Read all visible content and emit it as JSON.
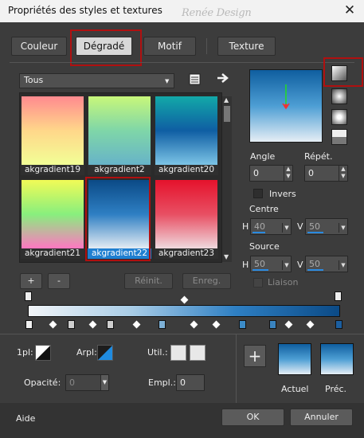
{
  "window": {
    "title": "Propriétés des styles et textures",
    "watermark": "Renée Design",
    "close": "✕"
  },
  "tabs": [
    {
      "label": "Couleur",
      "active": false
    },
    {
      "label": "Dégradé",
      "active": true
    },
    {
      "label": "Motif",
      "active": false
    },
    {
      "label": "Texture",
      "active": false
    }
  ],
  "category": {
    "value": "Tous"
  },
  "gradients": [
    {
      "name": "akgradient19",
      "colors": [
        "#ff8a8f",
        "#ffd78a",
        "#f2ff96"
      ]
    },
    {
      "name": "akgradient2",
      "colors": [
        "#c8f77a",
        "#7fd6a8",
        "#67b3c8"
      ]
    },
    {
      "name": "akgradient20",
      "colors": [
        "#12a9a8",
        "#0f5ea3",
        "#7cc4e6"
      ]
    },
    {
      "name": "akgradient21",
      "colors": [
        "#f1fb57",
        "#88ef7d",
        "#ff77c2"
      ]
    },
    {
      "name": "akgradient22",
      "colors": [
        "#0b4a86",
        "#2e7fc3",
        "#e4ecf3"
      ],
      "selected": true
    },
    {
      "name": "akgradient23",
      "colors": [
        "#e5122c",
        "#e84f63",
        "#efd9de"
      ]
    }
  ],
  "preview_gradient": {
    "colors": [
      "#0f5e9f",
      "#4d9ed4",
      "#e6eef5"
    ]
  },
  "styles": [
    "linear",
    "rectangular",
    "sunburst",
    "radial"
  ],
  "angle": {
    "label": "Angle",
    "value": "0"
  },
  "repeat": {
    "label": "Répét.",
    "value": "0"
  },
  "invert": {
    "label": "Invers",
    "checked": false
  },
  "center": {
    "label": "Centre",
    "h_label": "H",
    "h_value": "40",
    "v_label": "V",
    "v_value": "50"
  },
  "source": {
    "label": "Source",
    "h_label": "H",
    "h_value": "50",
    "v_label": "V",
    "v_value": "50",
    "link_label": "Liaison"
  },
  "buttons": {
    "add": "+",
    "remove": "-",
    "reset": "Réinit.",
    "save": "Enreg."
  },
  "bar_gradient": {
    "colors": [
      "#f2f5f8",
      "#a8cce6",
      "#2e7fc3",
      "#0b4a86"
    ]
  },
  "lower": {
    "pl_label": "1pl:",
    "arpl_label": "Arpl:",
    "util_label": "Util.:",
    "opacity_label": "Opacité:",
    "opacity_value": "0",
    "empl_label": "Empl.:",
    "empl_value": "0",
    "current_label": "Actuel",
    "previous_label": "Préc.",
    "plus": "+"
  },
  "footer": {
    "help": "Aide",
    "ok": "OK",
    "cancel": "Annuler"
  }
}
